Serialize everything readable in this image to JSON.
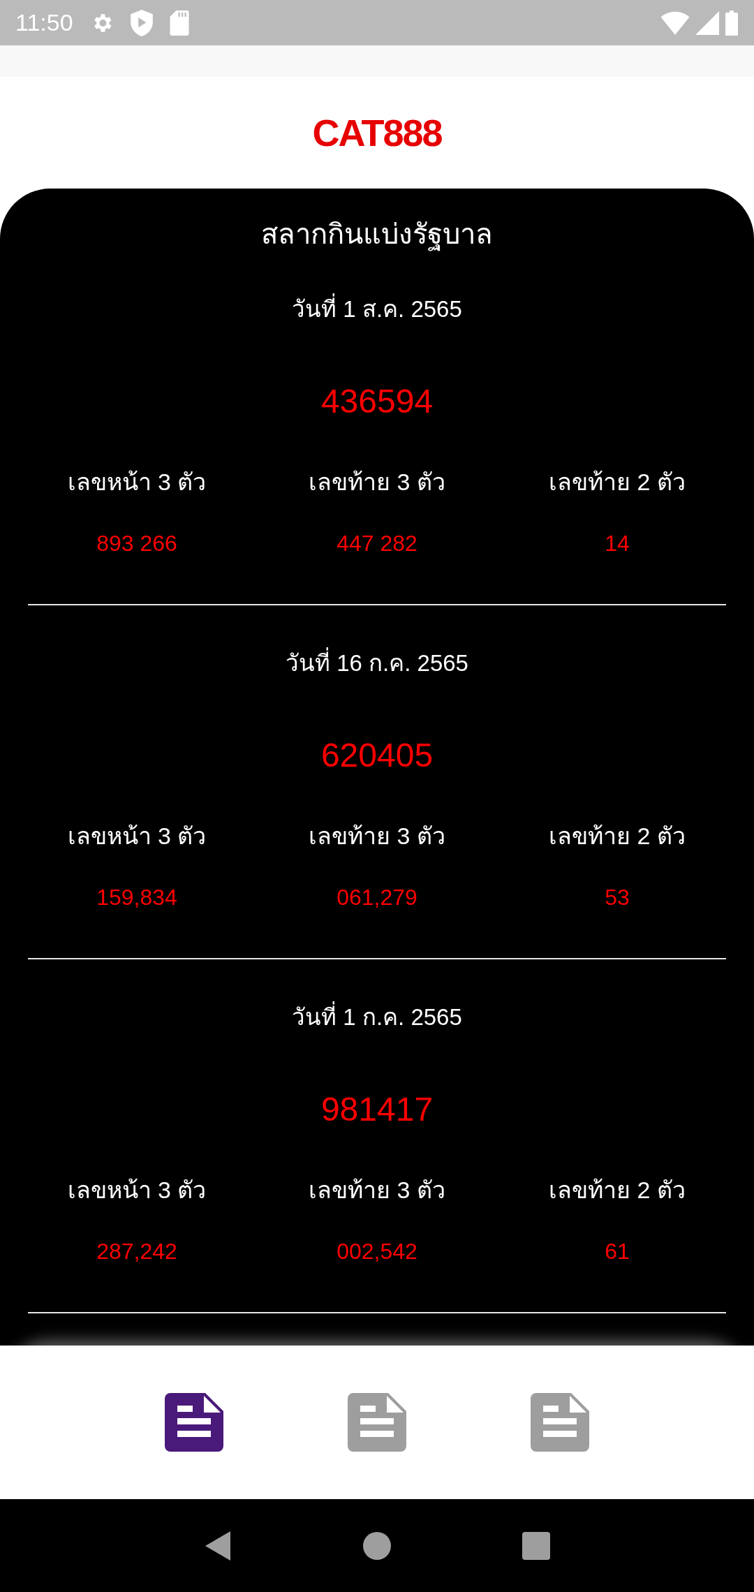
{
  "status_bar": {
    "time": "11:50"
  },
  "app_title": "CAT888",
  "panel": {
    "title": "สลากกินแบ่งรัฐบาล",
    "draws": [
      {
        "date": "วันที่ 1 ส.ค. 2565",
        "first_prize": "436594",
        "prizes": [
          {
            "label": "เลขหน้า 3 ตัว",
            "value": "893 266"
          },
          {
            "label": "เลขท้าย 3 ตัว",
            "value": "447 282"
          },
          {
            "label": "เลขท้าย 2 ตัว",
            "value": "14"
          }
        ]
      },
      {
        "date": "วันที่ 16 ก.ค. 2565",
        "first_prize": "620405",
        "prizes": [
          {
            "label": "เลขหน้า 3 ตัว",
            "value": "159,834"
          },
          {
            "label": "เลขท้าย 3 ตัว",
            "value": "061,279"
          },
          {
            "label": "เลขท้าย 2 ตัว",
            "value": "53"
          }
        ]
      },
      {
        "date": "วันที่ 1 ก.ค. 2565",
        "first_prize": "981417",
        "prizes": [
          {
            "label": "เลขหน้า 3 ตัว",
            "value": "287,242"
          },
          {
            "label": "เลขท้าย 3 ตัว",
            "value": "002,542"
          },
          {
            "label": "เลขท้าย 2 ตัว",
            "value": "61"
          }
        ]
      }
    ]
  },
  "bottom_tabs": [
    {
      "selected": true
    },
    {
      "selected": false
    },
    {
      "selected": false
    }
  ]
}
